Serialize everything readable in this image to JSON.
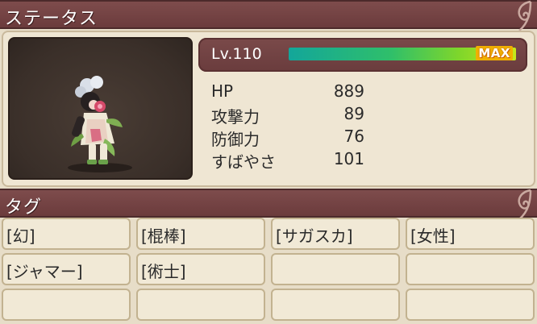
{
  "status_section": {
    "title": "ステータス"
  },
  "level": {
    "label": "Lv.110",
    "exp_fraction": 1.0,
    "max_label": "MAX"
  },
  "stats": [
    {
      "label": "HP",
      "value": "889"
    },
    {
      "label": "攻撃力",
      "value": "89"
    },
    {
      "label": "防御力",
      "value": "76"
    },
    {
      "label": "すばやさ",
      "value": "101"
    }
  ],
  "tags_section": {
    "title": "タグ"
  },
  "tags": [
    "[幻]",
    "[棍棒]",
    "[サガスカ]",
    "[女性]",
    "[ジャマー]",
    "[術士]",
    "",
    "",
    "",
    "",
    "",
    ""
  ],
  "colors": {
    "header_bg": "#6b3b3c",
    "panel_bg": "#efe6d3",
    "page_bg": "#e7ddc8",
    "exp_start": "#13a69a",
    "exp_end": "#c6e81a",
    "max_badge": "#f0b000"
  }
}
